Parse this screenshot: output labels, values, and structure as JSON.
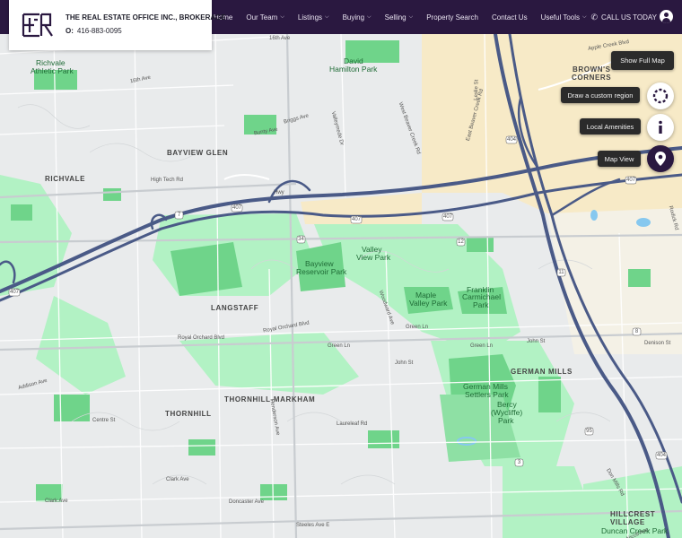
{
  "brand": {
    "name": "THE REAL ESTATE OFFICE INC., BROKERAGE",
    "phone_prefix": "O:",
    "phone": "416-883-0095"
  },
  "nav": {
    "items": [
      {
        "label": "Home",
        "has_menu": false
      },
      {
        "label": "Our Team",
        "has_menu": true
      },
      {
        "label": "Listings",
        "has_menu": true
      },
      {
        "label": "Buying",
        "has_menu": true
      },
      {
        "label": "Selling",
        "has_menu": true
      },
      {
        "label": "Property Search",
        "has_menu": false
      },
      {
        "label": "Contact Us",
        "has_menu": false
      },
      {
        "label": "Useful Tools",
        "has_menu": true
      }
    ],
    "call_label": "CALL US TODAY",
    "user_icon": "user-icon"
  },
  "map_controls": {
    "show_full_map": "Show Full Map",
    "draw_region": "Draw a custom region",
    "local_amenities": "Local Amenities",
    "map_view": "Map View"
  },
  "map": {
    "places": {
      "richvale": "RICHVALE",
      "bayview_glen": "BAYVIEW GLEN",
      "langstaff": "LANGSTAFF",
      "thornhill_markham": "THORNHILL-MARKHAM",
      "thornhill": "THORNHILL",
      "german_mills": "GERMAN MILLS",
      "browns_corners_1": "BROWN'S",
      "browns_corners_2": "CORNERS",
      "hillcrest_1": "HILLCREST",
      "hillcrest_2": "VILLAGE"
    },
    "parks": {
      "richvale_1": "Richvale",
      "richvale_2": "Athletic Park",
      "david_1": "David",
      "david_2": "Hamilton Park",
      "bayview_res_1": "Bayview",
      "bayview_res_2": "Reservoir Park",
      "valley_view_1": "Valley",
      "valley_view_2": "View Park",
      "maple_1": "Maple",
      "maple_2": "Valley Park",
      "franklin_1": "Franklin",
      "franklin_2": "Carmichael",
      "franklin_3": "Park",
      "gm_settlers_1": "German Mills",
      "gm_settlers_2": "Settlers Park",
      "bercy_1": "Bercy",
      "bercy_2": "(Wycliffe)",
      "bercy_3": "Park",
      "duncan": "Duncan Creek Park"
    },
    "streets": {
      "s16th": "16th Ave",
      "s16th_b": "16th Ave",
      "bunty": "Bunty Ave",
      "briggs": "Briggs Ave",
      "valleymede": "Valleymede Dr",
      "high_tech": "High Tech Rd",
      "west_beaver": "West Beaver Creek Rd",
      "east_beaver": "East Beaver Creek Rd",
      "leslie": "Leslie St",
      "apple_creek": "Apple Creek Blvd",
      "royal_orchard": "Royal Orchard Blvd",
      "royal_orchard_2": "Royal Orchard Blvd",
      "green_ln": "Green Ln",
      "green_ln_2": "Green Ln",
      "green_ln_3": "Green Ln",
      "woodward": "Woodward Ave",
      "john_st": "John St",
      "john_st_2": "John St",
      "denison": "Denison St",
      "addison": "Addison Ave",
      "centre": "Centre St",
      "laureleaf": "Laureleaf Rd",
      "clark": "Clark Ave",
      "clark_2": "Clark Ave",
      "doncaster": "Doncaster Ave",
      "steeles": "Steeles Ave E",
      "henderson": "Henderson Ave",
      "hwy": "Hwy",
      "don_mills": "Don Mills Rd",
      "mcnicoll": "McNicoll Ave",
      "rodick": "Rodick Rd"
    },
    "shields": {
      "h407": "407",
      "h404": "404",
      "h7": "7",
      "h12": "12",
      "h34": "34",
      "h11": "11",
      "h8": "8",
      "h95": "95",
      "h3": "3"
    },
    "colors": {
      "land": "#e9ebec",
      "park_light": "#b2f2c4",
      "park": "#6fd48a",
      "highway": "#4a5a87",
      "urban": "#f7eac7",
      "water": "#86c8ef"
    }
  }
}
